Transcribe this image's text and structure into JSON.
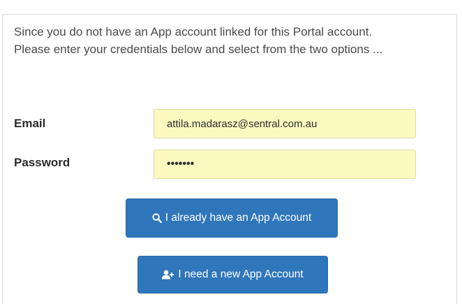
{
  "intro": {
    "line1": "Since you do not have an App account linked for this Portal account.",
    "line2": "Please enter your credentials below and select from the two options ..."
  },
  "form": {
    "email_label": "Email",
    "email_value": "attila.madarasz@sentral.com.au",
    "password_label": "Password",
    "password_value": "•••••••"
  },
  "buttons": {
    "existing_label": "I already have an App Account",
    "existing_icon": "search-icon",
    "new_label": "I need a new App Account",
    "new_icon": "add-user-icon"
  },
  "colors": {
    "button_blue": "#2f76bb",
    "input_yellow": "#fbf8c0"
  }
}
